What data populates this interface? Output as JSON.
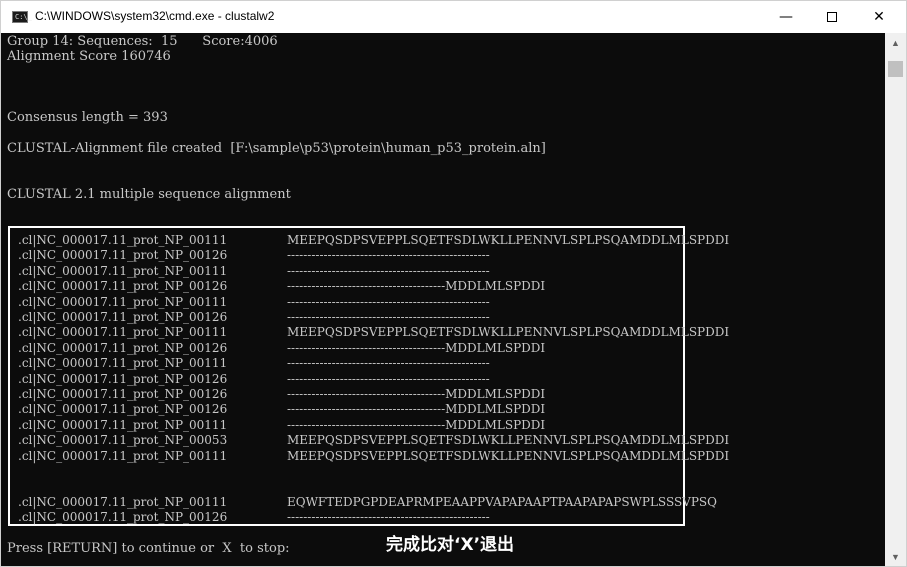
{
  "window": {
    "title": "C:\\WINDOWS\\system32\\cmd.exe - clustalw2",
    "icon_prompt": "C:\\_"
  },
  "console": {
    "lines": [
      "Group 14: Sequences:  15      Score:4006",
      "Alignment Score 160746",
      "Consensus length = 393",
      "CLUSTAL-Alignment file created  [F:\\sample\\p53\\protein\\human_p53_protein.aln]",
      "CLUSTAL 2.1 multiple sequence alignment"
    ],
    "prompt": "Press [RETURN] to continue or  X  to stop:"
  },
  "alignment": {
    "block1": [
      {
        "name": ".cl|NC_000017.11_prot_NP_00111",
        "seq": "MEEPQSDPSVEPPLSQETFSDLWKLLPENNVLSPLPSQAMDDLMLSPDDI"
      },
      {
        "name": ".cl|NC_000017.11_prot_NP_00126",
        "seq": "--------------------------------------------------"
      },
      {
        "name": ".cl|NC_000017.11_prot_NP_00111",
        "seq": "--------------------------------------------------"
      },
      {
        "name": ".cl|NC_000017.11_prot_NP_00126",
        "seq": "---------------------------------------MDDLMLSPDDI"
      },
      {
        "name": ".cl|NC_000017.11_prot_NP_00111",
        "seq": "--------------------------------------------------"
      },
      {
        "name": ".cl|NC_000017.11_prot_NP_00126",
        "seq": "--------------------------------------------------"
      },
      {
        "name": ".cl|NC_000017.11_prot_NP_00111",
        "seq": "MEEPQSDPSVEPPLSQETFSDLWKLLPENNVLSPLPSQAMDDLMLSPDDI"
      },
      {
        "name": ".cl|NC_000017.11_prot_NP_00126",
        "seq": "---------------------------------------MDDLMLSPDDI"
      },
      {
        "name": ".cl|NC_000017.11_prot_NP_00111",
        "seq": "--------------------------------------------------"
      },
      {
        "name": ".cl|NC_000017.11_prot_NP_00126",
        "seq": "--------------------------------------------------"
      },
      {
        "name": ".cl|NC_000017.11_prot_NP_00126",
        "seq": "---------------------------------------MDDLMLSPDDI"
      },
      {
        "name": ".cl|NC_000017.11_prot_NP_00126",
        "seq": "---------------------------------------MDDLMLSPDDI"
      },
      {
        "name": ".cl|NC_000017.11_prot_NP_00111",
        "seq": "---------------------------------------MDDLMLSPDDI"
      },
      {
        "name": ".cl|NC_000017.11_prot_NP_00053",
        "seq": "MEEPQSDPSVEPPLSQETFSDLWKLLPENNVLSPLPSQAMDDLMLSPDDI"
      },
      {
        "name": ".cl|NC_000017.11_prot_NP_00111",
        "seq": "MEEPQSDPSVEPPLSQETFSDLWKLLPENNVLSPLPSQAMDDLMLSPDDI"
      }
    ],
    "block2": [
      {
        "name": ".cl|NC_000017.11_prot_NP_00111",
        "seq": "EQWFTEDPGPDEAPRMPEAAPPVAPAPAAPTPAAPAPAPSWPLSSSVPSQ"
      },
      {
        "name": ".cl|NC_000017.11_prot_NP_00126",
        "seq": "--------------------------------------------------"
      }
    ]
  },
  "annotation": "完成比对‘X’退出",
  "colors": {
    "console_bg": "#0c0c0c",
    "console_text": "#c8c8c8",
    "highlight_box": "#ffffff"
  }
}
